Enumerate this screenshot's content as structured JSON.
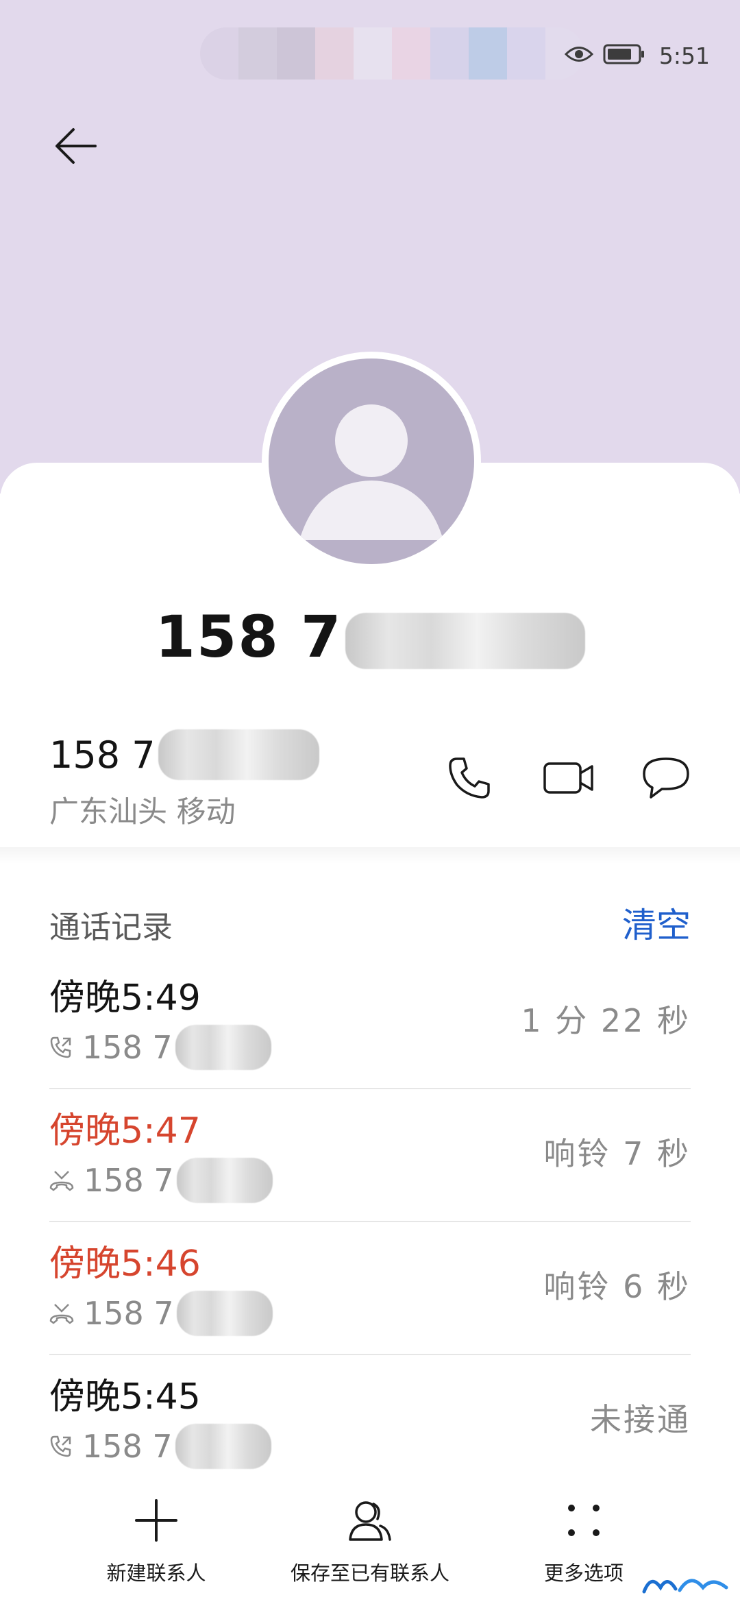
{
  "status_bar": {
    "time": "5:51",
    "icons": [
      "eye-icon",
      "battery-icon"
    ]
  },
  "header": {
    "back_icon": "arrow-left-icon",
    "title_number": "158 7"
  },
  "phone": {
    "number": "158 7",
    "location": "广东汕头 移动",
    "actions": [
      "phone-icon",
      "video-icon",
      "message-icon"
    ]
  },
  "call_log": {
    "title": "通话记录",
    "clear_label": "清空",
    "items": [
      {
        "time": "傍晚5:49",
        "number": "158 7",
        "duration": "1 分 22 秒",
        "status": "outgoing"
      },
      {
        "time": "傍晚5:47",
        "number": "158 7",
        "duration": "响铃 7 秒",
        "status": "missed"
      },
      {
        "time": "傍晚5:46",
        "number": "158 7",
        "duration": "响铃 6 秒",
        "status": "missed"
      },
      {
        "time": "傍晚5:45",
        "number": "158 7",
        "duration": "未接通",
        "status": "outgoing"
      }
    ]
  },
  "bottom_bar": {
    "new_contact": "新建联系人",
    "save_existing": "保存至已有联系人",
    "more_options": "更多选项"
  },
  "colors": {
    "header_bg": "#e2d9ec",
    "avatar_bg": "#b9b1c8",
    "missed_red": "#d6452e",
    "link_blue": "#1f5fcc"
  }
}
